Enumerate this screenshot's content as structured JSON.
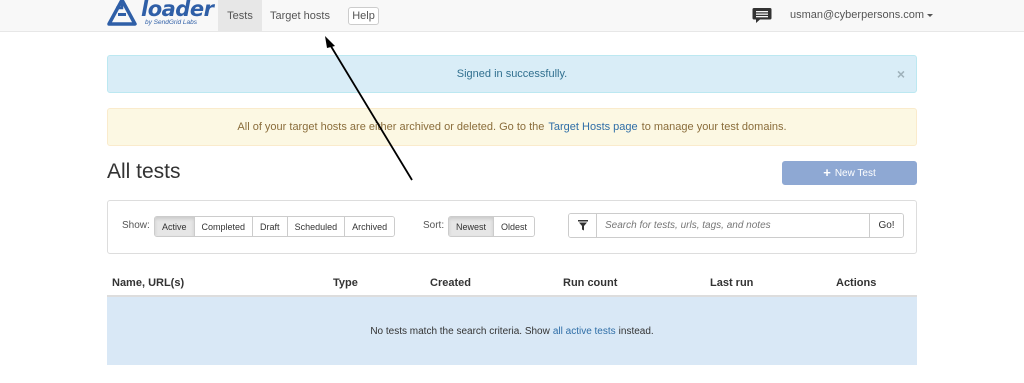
{
  "navbar": {
    "logo_word": "loader",
    "logo_sub": "by SendGrid Labs",
    "tabs": [
      {
        "label": "Tests",
        "active": true
      },
      {
        "label": "Target hosts",
        "active": false
      }
    ],
    "help_label": "Help",
    "chat_icon": "chat-bubble-icon",
    "user_email": "usman@cyberpersons.com"
  },
  "alerts": {
    "info_text": "Signed in successfully.",
    "info_close": "×",
    "warning_before": "All of your target hosts are either archived or deleted. Go to the",
    "warning_link": "Target Hosts page",
    "warning_after": "to manage your test domains."
  },
  "header": {
    "title": "All tests",
    "new_test_label": "New Test",
    "new_test_icon": "+"
  },
  "filters": {
    "show_label": "Show:",
    "show_options": [
      "Active",
      "Completed",
      "Draft",
      "Scheduled",
      "Archived"
    ],
    "show_selected": "Active",
    "sort_label": "Sort:",
    "sort_options": [
      "Newest",
      "Oldest"
    ],
    "sort_selected": "Newest",
    "search_placeholder": "Search for tests, urls, tags, and notes",
    "go_label": "Go!"
  },
  "table": {
    "columns": [
      "Name, URL(s)",
      "Type",
      "Created",
      "Run count",
      "Last run",
      "Actions"
    ],
    "empty_before": "No tests match the search criteria. Show",
    "empty_link": "all active tests",
    "empty_after": "instead."
  },
  "colors": {
    "brand": "#2f5fa7",
    "info_bg": "#d9edf7",
    "warning_bg": "#fcf8e3",
    "primary_disabled": "#8ea8d3",
    "empty_row_bg": "#d9e8f6"
  }
}
